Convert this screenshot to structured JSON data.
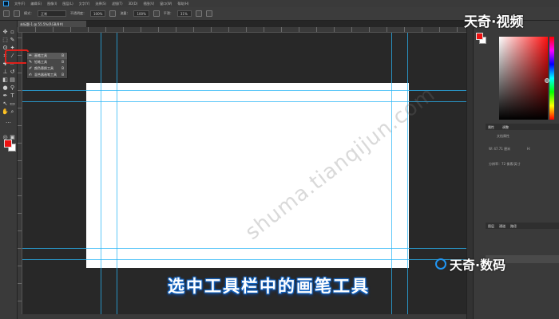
{
  "menu": {
    "items": [
      "文件(F)",
      "编辑(E)",
      "图像(I)",
      "图层(L)",
      "文字(Y)",
      "选择(S)",
      "滤镜(T)",
      "3D(D)",
      "视图(V)",
      "窗口(W)",
      "帮助(H)"
    ]
  },
  "options": {
    "mode_label": "模式：",
    "mode_value": "正常",
    "opacity_label": "不透明度：",
    "opacity_value": "100%",
    "flow_label": "流量：",
    "flow_value": "100%",
    "smooth_label": "平滑：",
    "smooth_value": "31%"
  },
  "document_tab": {
    "title": "未标题-1 @ 55.5%(RGB/8#)"
  },
  "flyout": {
    "items": [
      {
        "label": "画笔工具",
        "key": "B"
      },
      {
        "label": "铅笔工具",
        "key": "B"
      },
      {
        "label": "颜色替换工具",
        "key": "B"
      },
      {
        "label": "混合器画笔工具",
        "key": "B"
      }
    ]
  },
  "watermark": "shuma.tianqijun.com",
  "subtitle": "选中工具栏中的画笔工具",
  "brand": {
    "top": "天奇·视频",
    "bottom": "天奇·数码"
  },
  "panel": {
    "properties_tab": "属性",
    "adjustments_tab": "调整",
    "doc_props": "文档属性",
    "width_label": "W: 47.71 厘米",
    "height_label": "H:",
    "resolution_label": "分辨率：72 像素/英寸",
    "layers_tab": "图层",
    "channels_tab": "通道",
    "paths_tab": "路径"
  },
  "colors": {
    "foreground": "#ee1111",
    "background": "#ffffff",
    "guide": "#29b6f6",
    "highlight": "#e0201a"
  },
  "icons": [
    "move-icon",
    "marquee-icon",
    "lasso-icon",
    "crop-icon",
    "brush-icon",
    "stamp-icon",
    "eraser-icon",
    "pen-icon",
    "text-icon",
    "hand-icon",
    "zoom-icon"
  ]
}
